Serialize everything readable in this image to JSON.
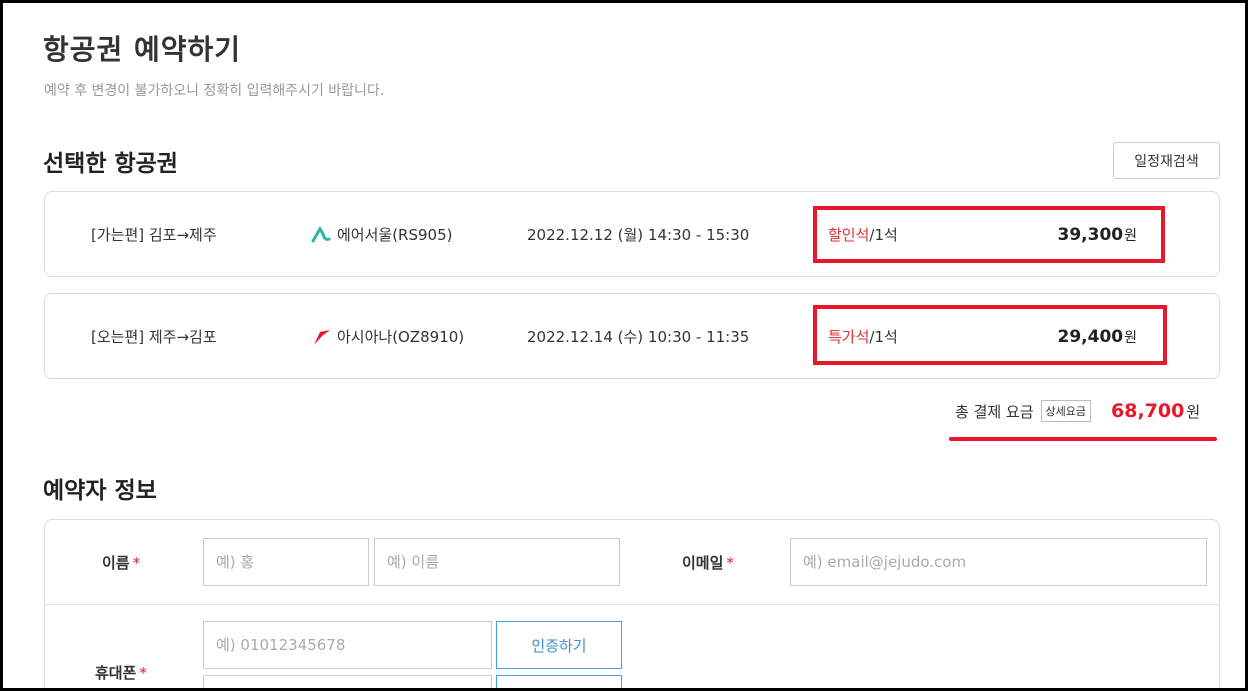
{
  "page": {
    "title": "항공권 예약하기",
    "subtitle": "예약 후 변경이 불가하오니 정확히 입력해주시기 바랍니다."
  },
  "selected": {
    "title": "선택한 항공권",
    "research_label": "일정재검색",
    "flights": [
      {
        "route": "[가는편] 김포→제주",
        "airline": "에어서울(RS905)",
        "airline_icon": "air-seoul-logo",
        "datetime": "2022.12.12 (월) 14:30 - 15:30",
        "seat_class": "할인석",
        "seat_count": "/1석",
        "price": "39,300",
        "price_unit": "원"
      },
      {
        "route": "[오는편] 제주→김포",
        "airline": "아시아나(OZ8910)",
        "airline_icon": "asiana-logo",
        "datetime": "2022.12.14 (수) 10:30 - 11:35",
        "seat_class": "특가석",
        "seat_count": "/1석",
        "price": "29,400",
        "price_unit": "원"
      }
    ],
    "total": {
      "label": "총 결제 요금",
      "detail_label": "상세요금",
      "amount": "68,700",
      "unit": "원"
    },
    "highlight_color": "#e8182a"
  },
  "booker": {
    "title": "예약자 정보",
    "name_label": "이름",
    "email_label": "이메일",
    "phone_label": "휴대폰",
    "required_mark": "*",
    "last_name_placeholder": "예) 홍",
    "first_name_placeholder": "예) 이름",
    "email_placeholder": "예) email@jejudo.com",
    "phone_placeholder": "예) 01012345678",
    "verify_label": "인증하기"
  },
  "colors": {
    "accent_red": "#e8182a",
    "seat_red": "#d33",
    "button_blue": "#3d8fcf"
  }
}
